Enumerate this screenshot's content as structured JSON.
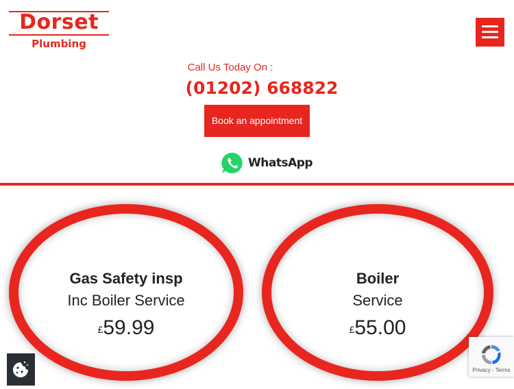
{
  "header": {
    "logo_main": "Dorset",
    "logo_sub": "Plumbing",
    "menu_icon": "hamburger-menu-icon"
  },
  "contact": {
    "call_label": "Call Us Today On :",
    "phone": "(01202) 668822",
    "book_label": "Book an appointment",
    "whatsapp_label": "WhatsApp",
    "whatsapp_icon": "whatsapp-icon"
  },
  "offers": [
    {
      "title": "Gas Safety insp",
      "subtitle": "Inc Boiler Service",
      "currency": "£",
      "price": "59.99"
    },
    {
      "title": "Boiler",
      "subtitle": "Service",
      "currency": "£",
      "price": "55.00"
    }
  ],
  "overlays": {
    "cookie_icon": "cookie-icon",
    "recaptcha_text": "Privacy - Terms"
  },
  "colors": {
    "brand_red": "#e8261f",
    "whatsapp_green": "#25d366",
    "cookie_bg": "#2a2f36"
  }
}
